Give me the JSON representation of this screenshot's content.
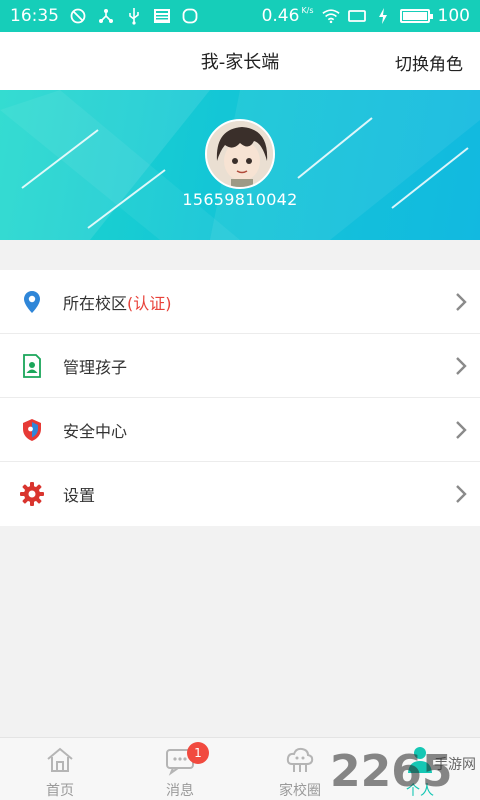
{
  "status_bar": {
    "time": "16:35",
    "speed": "0.46",
    "speed_unit": "K/s",
    "battery": "100",
    "battery_level": 1.0
  },
  "header": {
    "title": "我-家长端",
    "switch_role": "切换角色"
  },
  "profile": {
    "phone": "15659810042"
  },
  "menu": {
    "items": [
      {
        "label": "所在校区",
        "suffix": "(认证)",
        "icon": "location-pin-icon"
      },
      {
        "label": "管理孩子",
        "icon": "child-card-icon"
      },
      {
        "label": "安全中心",
        "icon": "shield-icon"
      },
      {
        "label": "设置",
        "icon": "gear-icon"
      }
    ]
  },
  "tabs": [
    {
      "label": "首页",
      "icon": "home-icon"
    },
    {
      "label": "消息",
      "icon": "message-icon",
      "badge": "1"
    },
    {
      "label": "家校圈",
      "icon": "school-circle-icon"
    },
    {
      "label": "个人",
      "icon": "person-icon",
      "active": true
    }
  ],
  "watermark": {
    "number": "2265",
    "text": "手游网"
  },
  "colors": {
    "accent": "#16ceb9",
    "warn": "#e8423a",
    "badge": "#f14a3f"
  }
}
